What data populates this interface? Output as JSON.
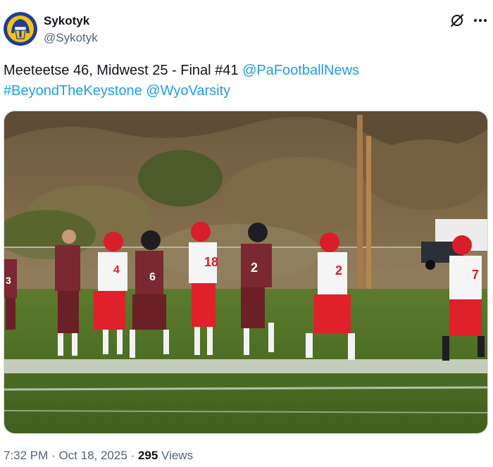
{
  "author": {
    "name": "Sykotyk",
    "handle": "@Sykotyk",
    "avatar_logo_text": "TROJANS"
  },
  "header_icons": {
    "grok": "grok-icon",
    "more": "more-options-icon"
  },
  "tweet": {
    "text_plain": "Meeteetse 46, Midwest 25 - Final #41",
    "mention_1": "@PaFootballNews",
    "hashtag_1": "#BeyondTheKeystone",
    "mention_2": "@WyoVarsity"
  },
  "media": {
    "jersey_numbers": [
      "3",
      "4",
      "6",
      "18",
      "2",
      "2",
      "7"
    ]
  },
  "meta": {
    "time": "7:32 PM",
    "sep1": "·",
    "date": "Oct 18, 2025",
    "sep2": "·",
    "views_count": "295",
    "views_label": "Views"
  },
  "colors": {
    "link": "#1d9bf0",
    "text": "#0f1419",
    "muted": "#536471",
    "maroon_jersey": "#7a2832",
    "red_pants": "#e0202a",
    "avatar_navy": "#1f3f8f",
    "avatar_gold": "#f2c21b"
  }
}
